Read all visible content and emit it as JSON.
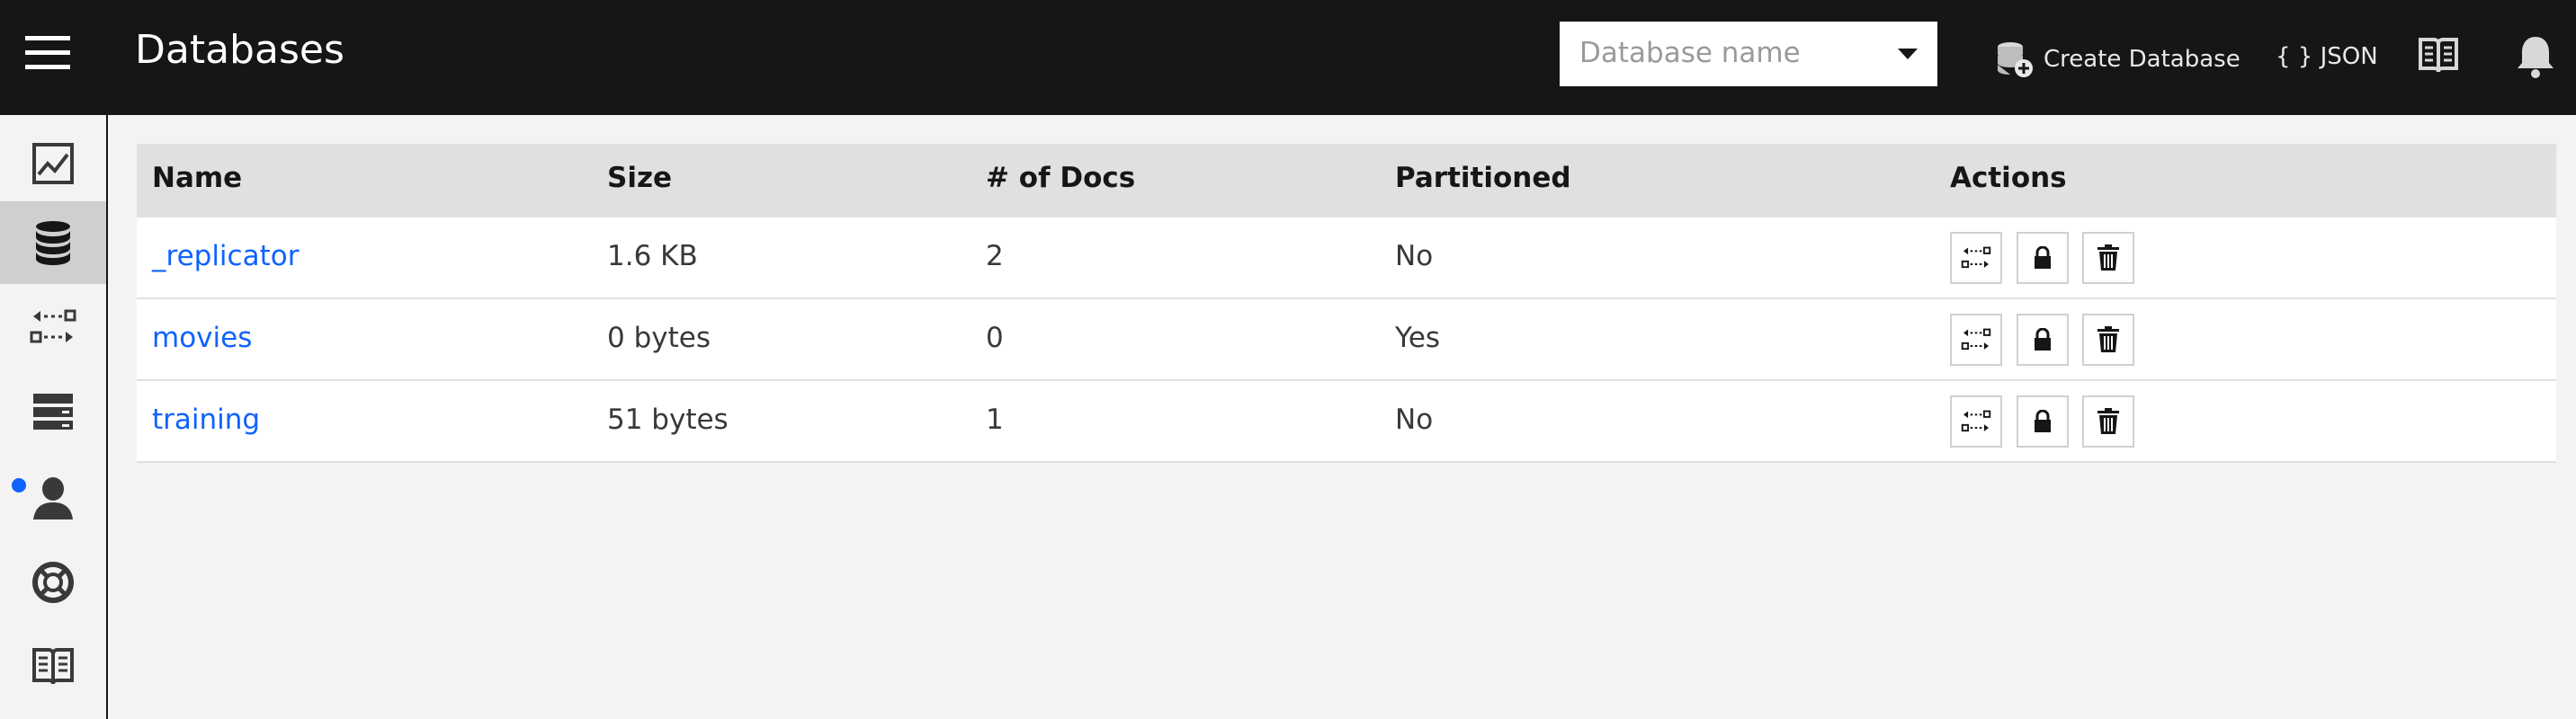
{
  "header": {
    "title": "Databases",
    "search_placeholder": "Database name",
    "create_label": "Create Database",
    "json_label": "{ } JSON"
  },
  "sidebar": {
    "items": [
      {
        "name": "activity",
        "icon": "chart-line-icon"
      },
      {
        "name": "databases",
        "icon": "database-icon",
        "active": true
      },
      {
        "name": "replication",
        "icon": "replicate-icon"
      },
      {
        "name": "active-tasks",
        "icon": "server-icon"
      },
      {
        "name": "user",
        "icon": "user-icon",
        "notification": true
      },
      {
        "name": "support",
        "icon": "lifebuoy-icon"
      },
      {
        "name": "documentation",
        "icon": "book-icon"
      }
    ]
  },
  "table": {
    "columns": [
      "Name",
      "Size",
      "# of Docs",
      "Partitioned",
      "Actions"
    ],
    "rows": [
      {
        "name": "_replicator",
        "size": "1.6 KB",
        "docs": "2",
        "partitioned": "No"
      },
      {
        "name": "movies",
        "size": "0 bytes",
        "docs": "0",
        "partitioned": "Yes"
      },
      {
        "name": "training",
        "size": "51 bytes",
        "docs": "1",
        "partitioned": "No"
      }
    ]
  },
  "colors": {
    "topbar": "#161616",
    "link": "#0f62fe",
    "header_row": "#e0e0e0",
    "notification": "#0f62fe"
  }
}
